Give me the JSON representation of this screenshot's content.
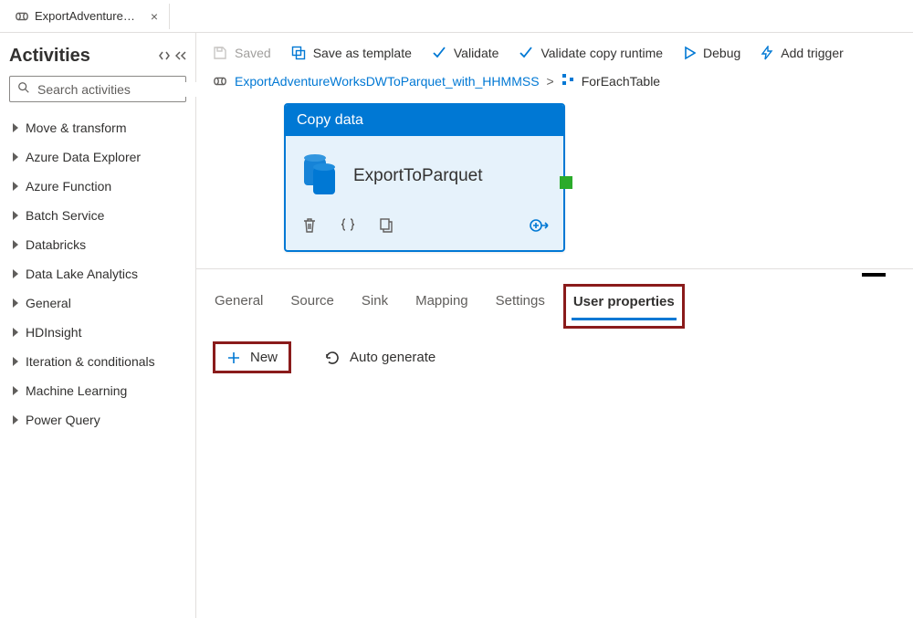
{
  "tab": {
    "title": "ExportAdventureW..."
  },
  "sidebar": {
    "title": "Activities",
    "search_placeholder": "Search activities",
    "items": [
      {
        "label": "Move & transform"
      },
      {
        "label": "Azure Data Explorer"
      },
      {
        "label": "Azure Function"
      },
      {
        "label": "Batch Service"
      },
      {
        "label": "Databricks"
      },
      {
        "label": "Data Lake Analytics"
      },
      {
        "label": "General"
      },
      {
        "label": "HDInsight"
      },
      {
        "label": "Iteration & conditionals"
      },
      {
        "label": "Machine Learning"
      },
      {
        "label": "Power Query"
      }
    ]
  },
  "toolbar": {
    "saved": "Saved",
    "save_as_template": "Save as template",
    "validate": "Validate",
    "validate_copy_runtime": "Validate copy runtime",
    "debug": "Debug",
    "add_trigger": "Add trigger"
  },
  "breadcrumb": {
    "root": "ExportAdventureWorksDWToParquet_with_HHMMSS",
    "child": "ForEachTable"
  },
  "activity": {
    "type_label": "Copy data",
    "name": "ExportToParquet"
  },
  "panel_tabs": {
    "general": "General",
    "source": "Source",
    "sink": "Sink",
    "mapping": "Mapping",
    "settings": "Settings",
    "user_properties": "User properties"
  },
  "panel_actions": {
    "new": "New",
    "auto_generate": "Auto generate"
  }
}
